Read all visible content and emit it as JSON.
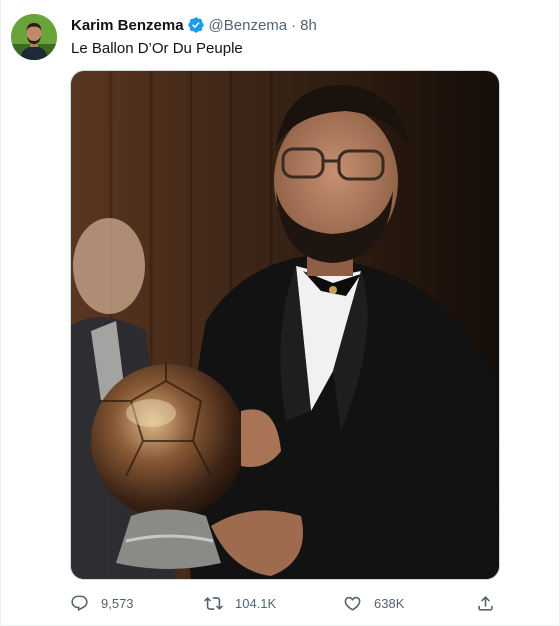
{
  "tweet": {
    "display_name": "Karim Benzema",
    "handle": "@Benzema",
    "separator": "·",
    "time": "8h",
    "text": "Le Ballon D’Or Du Peuple"
  },
  "actions": {
    "replies": "9,573",
    "retweets": "104.1K",
    "likes": "638K"
  },
  "colors": {
    "verified": "#1d9bf0",
    "secondary_text": "#536471",
    "primary_text": "#0f1419"
  },
  "icons": {
    "verified": "verified-badge-icon",
    "reply": "reply-icon",
    "retweet": "retweet-icon",
    "like": "heart-icon",
    "share": "share-icon"
  }
}
